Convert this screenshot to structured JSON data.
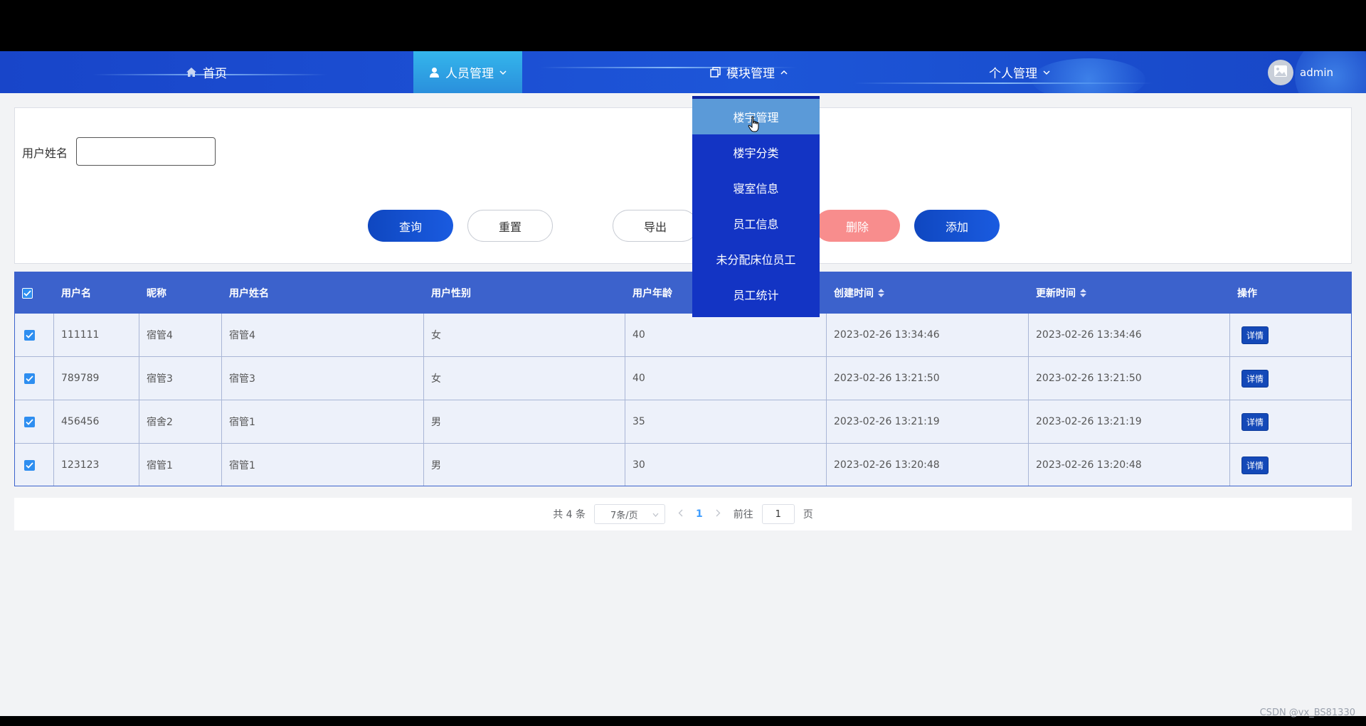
{
  "nav": {
    "home": "首页",
    "people": "人员管理",
    "modules": "模块管理",
    "personal": "个人管理",
    "user": "admin"
  },
  "dropdown": {
    "items": [
      "楼宇管理",
      "楼宇分类",
      "寝室信息",
      "员工信息",
      "未分配床位员工",
      "员工统计"
    ],
    "hovered_index": 0
  },
  "search": {
    "label": "用户姓名",
    "value": "",
    "buttons": {
      "query": "查询",
      "reset": "重置",
      "export": "导出",
      "delete": "删除",
      "add": "添加"
    }
  },
  "table": {
    "headers": [
      "用户名",
      "昵称",
      "用户姓名",
      "用户性别",
      "用户年龄",
      "创建时间",
      "更新时间",
      "操作"
    ],
    "rows": [
      [
        "111111",
        "宿管4",
        "宿管4",
        "女",
        "40",
        "2023-02-26 13:34:46",
        "2023-02-26 13:34:46",
        "详情"
      ],
      [
        "789789",
        "宿管3",
        "宿管3",
        "女",
        "40",
        "2023-02-26 13:21:50",
        "2023-02-26 13:21:50",
        "详情"
      ],
      [
        "456456",
        "宿舍2",
        "宿管1",
        "男",
        "35",
        "2023-02-26 13:21:19",
        "2023-02-26 13:21:19",
        "详情"
      ],
      [
        "123123",
        "宿管1",
        "宿管1",
        "男",
        "30",
        "2023-02-26 13:20:48",
        "2023-02-26 13:20:48",
        "详情"
      ]
    ]
  },
  "pager": {
    "total": "共 4 条",
    "page_size": "7条/页",
    "current_page": "1",
    "goto_prefix": "前往",
    "goto_value": "1",
    "goto_suffix": "页"
  },
  "watermark": "CSDN @vx_BS81330",
  "colors": {
    "nav": "#1c4fd3",
    "active_nav": "#34b6ec",
    "dropdown": "#1334c4",
    "dropdown_hover": "#5b9ad8",
    "table_header": "#3c62cc",
    "primary_button": "#1a5be0",
    "danger_button": "#f88d8d"
  }
}
